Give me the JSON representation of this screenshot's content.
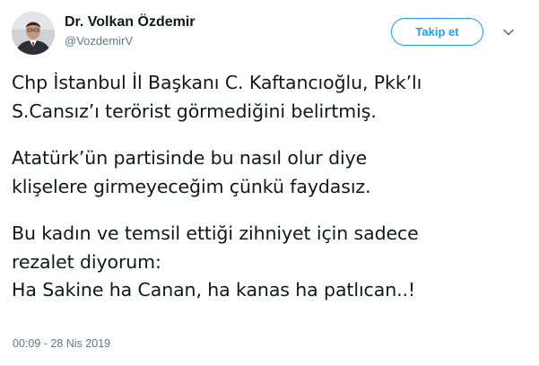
{
  "author": {
    "name": "Dr. Volkan Özdemir",
    "handle": "@VozdemirV"
  },
  "follow_button": {
    "label": "Takip et"
  },
  "menu": {
    "icon": "chevron-down-icon"
  },
  "tweet": {
    "paragraphs": [
      [
        "Chp İstanbul İl Başkanı C. Kaftancıoğlu, Pkk’lı",
        "S.Cansız’ı terörist görmediğini belirtmiş."
      ],
      [
        "Atatürk’ün partisinde bu nasıl olur diye",
        "klişelere girmeyeceğim çünkü faydasız."
      ],
      [
        "Bu kadın ve temsil ettiği zihniyet için sadece",
        "rezalet diyorum:",
        "Ha Sakine ha Canan, ha kanas ha patlıcan..!"
      ]
    ],
    "timestamp": "00:09 - 28 Nis 2019"
  },
  "colors": {
    "accent": "#1da1f2",
    "text": "#14171a",
    "secondary_text": "#657786",
    "divider": "#e6ecf0"
  }
}
